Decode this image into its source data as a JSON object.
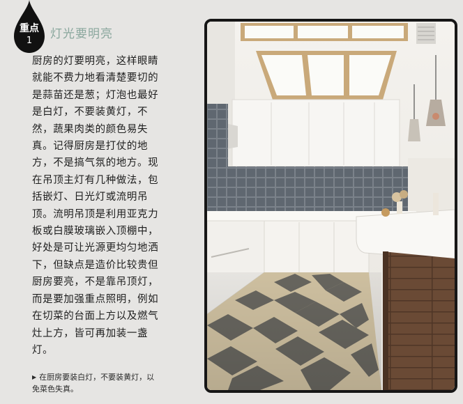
{
  "badge": {
    "label": "重点",
    "number": "1"
  },
  "section_title": "灯光要明亮",
  "body_lines": [
    "厨房的灯要明亮，这样眼睛",
    "就能不费力地看清楚要切的",
    "是蒜苗还是葱；灯泡也最好",
    "是白灯，不要装黄灯，不",
    "然，蔬果肉类的颜色易失",
    "真。记得厨房是打仗的地",
    "方，不是搞气氛的地方。现",
    "在吊顶主灯有几种做法，包",
    "括嵌灯、日光灯或流明吊",
    "顶。流明吊顶是利用亚克力",
    "板或白膜玻璃嵌入顶棚中，",
    "好处是可让光源更均匀地洒",
    "下，但缺点是造价比较贵但",
    "厨房要亮，不是靠吊顶灯，",
    "而是要加强重点照明，例如",
    "在切菜的台面上方以及燃气",
    "灶上方，皆可再加装一盏",
    "灯。"
  ],
  "caption_lines": [
    "在厨房要装白灯，不要装黄灯，以",
    "免菜色失真。"
  ],
  "colors": {
    "badge": "#111111",
    "title": "#8aa79d",
    "frame": "#161616",
    "tile_dark": "#6c6a63",
    "tile_light": "#d8c9a8",
    "backsplash": "#5f6770",
    "wood": "#6a4a35"
  }
}
